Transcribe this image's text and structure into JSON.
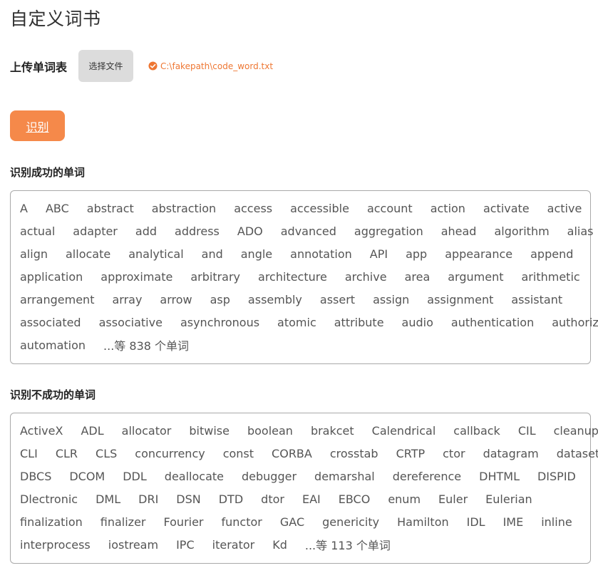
{
  "page": {
    "title": "自定义词书"
  },
  "upload": {
    "label": "上传单词表",
    "choose_file_button": "选择文件",
    "file_path": "C:\\fakepath\\code_word.txt"
  },
  "actions": {
    "recognize_label": "识别"
  },
  "success_section": {
    "title": "识别成功的单词",
    "rows": [
      [
        "A",
        "ABC",
        "abstract",
        "abstraction",
        "access",
        "accessible",
        "account",
        "action",
        "activate",
        "active"
      ],
      [
        "actual",
        "adapter",
        "add",
        "address",
        "ADO",
        "advanced",
        "aggregation",
        "ahead",
        "algorithm",
        "alias"
      ],
      [
        "align",
        "allocate",
        "analytical",
        "and",
        "angle",
        "annotation",
        "API",
        "app",
        "appearance",
        "append"
      ],
      [
        "application",
        "approximate",
        "arbitrary",
        "architecture",
        "archive",
        "area",
        "argument",
        "arithmetic"
      ],
      [
        "arrangement",
        "array",
        "arrow",
        "asp",
        "assembly",
        "assert",
        "assign",
        "assignment",
        "assistant"
      ],
      [
        "associated",
        "associative",
        "asynchronous",
        "atomic",
        "attribute",
        "audio",
        "authentication",
        "authorization"
      ],
      [
        "automation"
      ]
    ],
    "more_label": "...等 838 个单词"
  },
  "fail_section": {
    "title": "识别不成功的单词",
    "rows": [
      [
        "ActiveX",
        "ADL",
        "allocator",
        "bitwise",
        "boolean",
        "brakcet",
        "Calendrical",
        "callback",
        "CIL",
        "cleanup"
      ],
      [
        "CLI",
        "CLR",
        "CLS",
        "concurrency",
        "const",
        "CORBA",
        "crosstab",
        "CRTP",
        "ctor",
        "datagram",
        "dataset"
      ],
      [
        "DBCS",
        "DCOM",
        "DDL",
        "deallocate",
        "debugger",
        "demarshal",
        "dereference",
        "DHTML",
        "DISPID"
      ],
      [
        "Dlectronic",
        "DML",
        "DRI",
        "DSN",
        "DTD",
        "dtor",
        "EAI",
        "EBCO",
        "enum",
        "Euler",
        "Eulerian"
      ],
      [
        "finalization",
        "finalizer",
        "Fourier",
        "functor",
        "GAC",
        "genericity",
        "Hamilton",
        "IDL",
        "IME",
        "inline"
      ],
      [
        "interprocess",
        "iostream",
        "IPC",
        "iterator",
        "Kd"
      ]
    ],
    "more_label": "...等 113 个单词"
  },
  "colors": {
    "accent": "#f5894a",
    "file_status": "#ee7733",
    "word_text": "#555555",
    "file_button_bg": "#dcdcdc"
  },
  "icons": {
    "file_status": "check-circle-icon"
  }
}
